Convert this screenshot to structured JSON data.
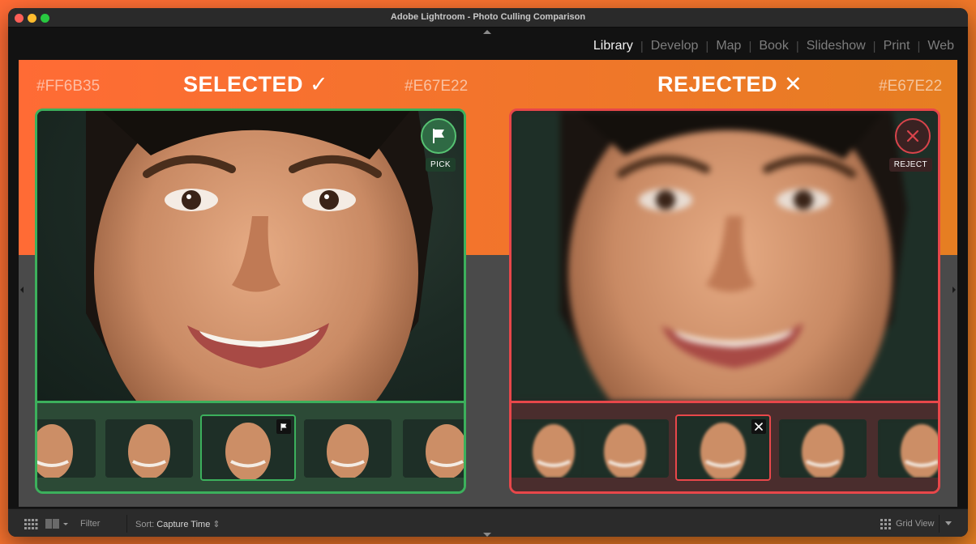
{
  "window": {
    "title": "Adobe Lightroom - Photo Culling Comparison"
  },
  "modules": [
    {
      "label": "Library",
      "active": true
    },
    {
      "label": "Develop",
      "active": false
    },
    {
      "label": "Map",
      "active": false
    },
    {
      "label": "Book",
      "active": false
    },
    {
      "label": "Slideshow",
      "active": false
    },
    {
      "label": "Print",
      "active": false
    },
    {
      "label": "Web",
      "active": false
    }
  ],
  "colors": {
    "accent_start": "#FF6B35",
    "accent_end": "#E67E22",
    "selected": "#3cb05c",
    "rejected": "#e8474a"
  },
  "selected": {
    "hex_left": "#FF6B35",
    "hex_right": "#E67E22",
    "heading": "SELECTED ✓",
    "tag": "PICK",
    "button_icon": "flag-icon",
    "thumb_badge_icon": "flag-icon"
  },
  "rejected": {
    "hex_right": "#E67E22",
    "heading": "REJECTED ✕",
    "tag": "REJECT",
    "button_icon": "x-circle-icon",
    "thumb_badge_icon": "x-icon"
  },
  "toolbar": {
    "filter_label": "Filter",
    "sort_label": "Sort:",
    "sort_value": "Capture Time",
    "view_label": "Grid View",
    "grid_icon": "grid-icon",
    "compare_icon": "compare-view-icon"
  }
}
